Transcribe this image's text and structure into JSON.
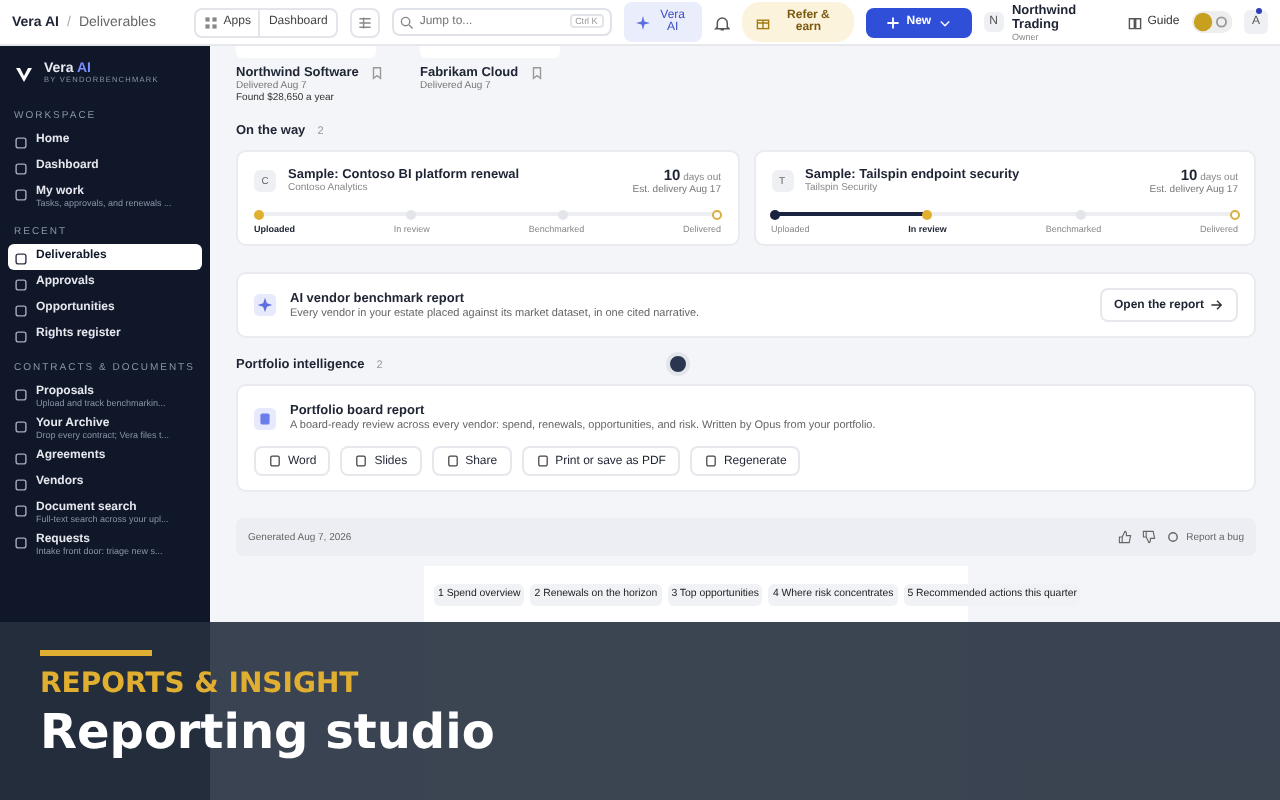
{
  "topbar": {
    "breadcrumb": [
      "Vera AI",
      "Deliverables"
    ],
    "breadcrumb_separator": "/",
    "apps": "Apps",
    "dashboard": "Dashboard",
    "search": {
      "placeholder": "Jump to...",
      "shortcut": "Ctrl K"
    },
    "vera_button": "Vera AI",
    "refer": "Refer & earn",
    "new_button": "New",
    "org": {
      "initial": "N",
      "name": "Northwind Trading",
      "role": "Owner"
    },
    "guide": "Guide",
    "avatar": "A"
  },
  "sidebar": {
    "brand": {
      "name": "Vera",
      "accent": "AI",
      "sub": "BY VENDORBENCHMARK"
    },
    "sections": [
      {
        "title": "WORKSPACE",
        "items": [
          {
            "label": "Home",
            "selected": false
          },
          {
            "label": "Dashboard",
            "selected": false
          },
          {
            "label": "My work",
            "sub": "Tasks, approvals, and renewals ...",
            "selected": false
          }
        ]
      },
      {
        "title": "RECENT",
        "items": [
          {
            "label": "Deliverables",
            "selected": true
          },
          {
            "label": "Approvals",
            "selected": false
          },
          {
            "label": "Opportunities",
            "selected": false
          },
          {
            "label": "Rights register",
            "selected": false
          }
        ]
      },
      {
        "title": "CONTRACTS & DOCUMENTS",
        "items": [
          {
            "label": "Proposals",
            "sub": "Upload and track benchmarkin...",
            "selected": false
          },
          {
            "label": "Your Archive",
            "sub": "Drop every contract; Vera files t...",
            "selected": false
          },
          {
            "label": "Agreements",
            "selected": false
          },
          {
            "label": "Vendors",
            "selected": false
          },
          {
            "label": "Document search",
            "sub": "Full-text search across your upl...",
            "selected": false
          },
          {
            "label": "Requests",
            "sub": "Intake front door: triage new s...",
            "selected": false
          }
        ]
      }
    ]
  },
  "delivered": [
    {
      "name": "Northwind Software",
      "date": "Delivered Aug 7",
      "note": "Found $28,650 a year"
    },
    {
      "name": "Fabrikam Cloud",
      "date": "Delivered Aug 7"
    }
  ],
  "on_the_way": {
    "title": "On the way",
    "count": "2",
    "cards": [
      {
        "initial": "C",
        "title": "Sample: Contoso BI platform renewal",
        "vendor": "Contoso Analytics",
        "days": "10",
        "days_label": "days out",
        "eta": "Est. delivery Aug 17",
        "stages": [
          {
            "label": "Uploaded",
            "selected": true
          },
          {
            "label": "In review",
            "selected": false
          },
          {
            "label": "Benchmarked",
            "selected": false
          },
          {
            "label": "Delivered",
            "selected": false
          }
        ]
      },
      {
        "initial": "T",
        "title": "Sample: Tailspin endpoint security",
        "vendor": "Tailspin Security",
        "days": "10",
        "days_label": "days out",
        "eta": "Est. delivery Aug 17",
        "stages": [
          {
            "label": "Uploaded",
            "selected": false
          },
          {
            "label": "In review",
            "selected": true
          },
          {
            "label": "Benchmarked",
            "selected": false
          },
          {
            "label": "Delivered",
            "selected": false
          }
        ]
      }
    ]
  },
  "benchmark": {
    "title": "AI vendor benchmark report",
    "text": "Every vendor in your estate placed against its market dataset, in one cited narrative.",
    "button": "Open the report"
  },
  "portfolio": {
    "title": "Portfolio intelligence",
    "count": "2",
    "card": {
      "title": "Portfolio board report",
      "text": "A board-ready review across every vendor: spend, renewals, opportunities, and risk. Written by Opus from your portfolio.",
      "actions": [
        "Word",
        "Slides",
        "Share",
        "Print or save as PDF",
        "Regenerate"
      ]
    }
  },
  "footer": {
    "generated": "Generated Aug 7, 2026",
    "bug": "Report a bug"
  },
  "preview": {
    "chips": [
      "1 Spend overview",
      "2 Renewals on the horizon",
      "3 Top opportunities",
      "4 Where risk concentrates",
      "5 Recommended actions this quarter"
    ]
  },
  "banner": {
    "kicker": "REPORTS & INSIGHT",
    "title": "Reporting studio"
  }
}
